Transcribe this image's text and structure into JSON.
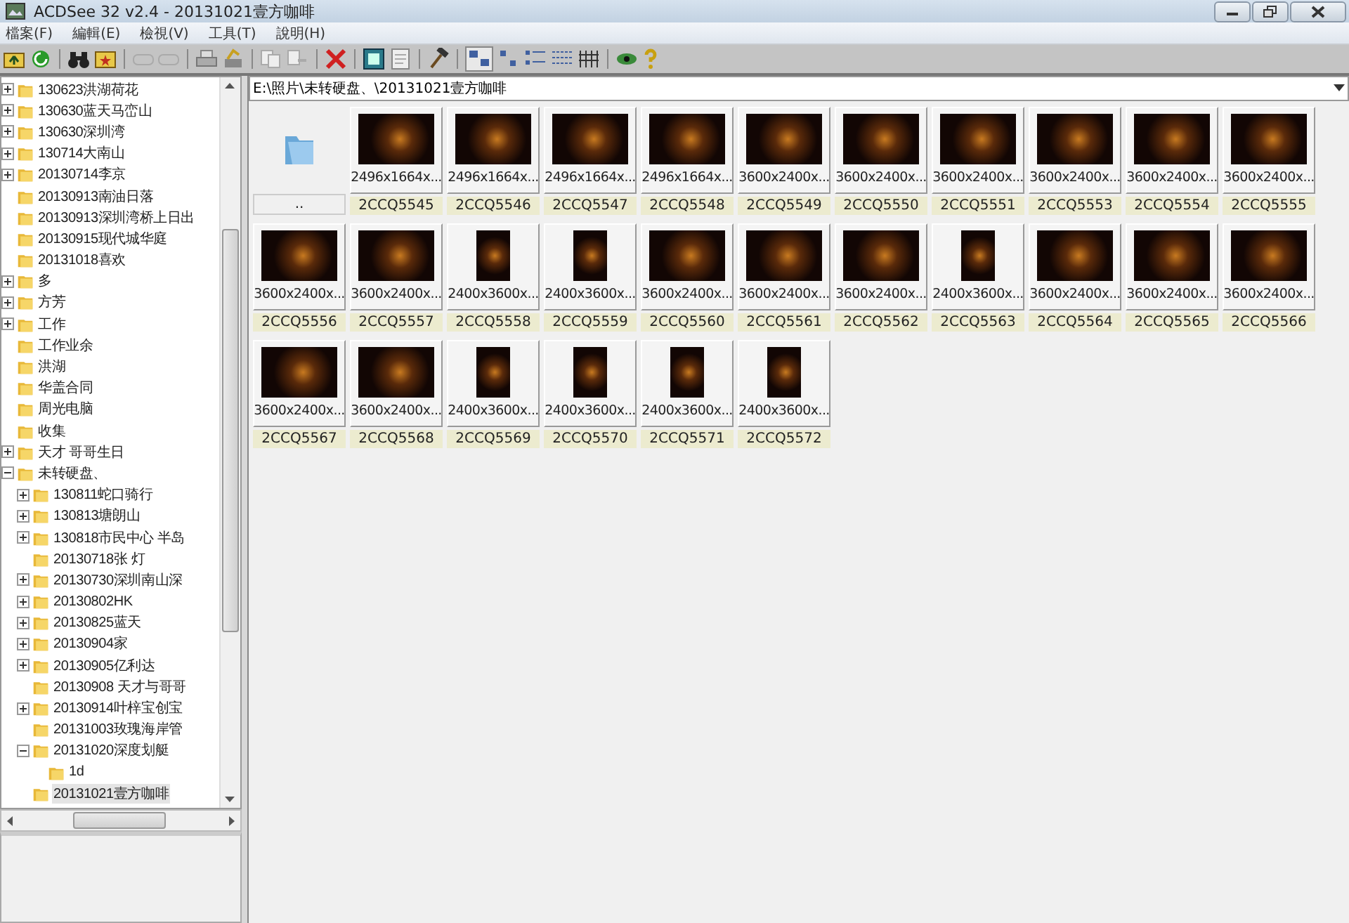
{
  "window": {
    "title": "ACDSee 32 v2.4 - 20131021壹方咖啡"
  },
  "menu": [
    "檔案(F)",
    "編輯(E)",
    "檢視(V)",
    "工具(T)",
    "說明(H)"
  ],
  "address": {
    "value": "E:\\照片\\未转硬盘、\\20131021壹方咖啡"
  },
  "tree": [
    {
      "label": "130623洪湖荷花",
      "expandable": true,
      "selected": false
    },
    {
      "label": "130630蓝天马峦山",
      "expandable": true,
      "selected": false
    },
    {
      "label": "130630深圳湾",
      "expandable": true,
      "selected": false
    },
    {
      "label": "130714大南山",
      "expandable": true,
      "selected": false
    },
    {
      "label": "20130714李京",
      "expandable": true,
      "selected": false
    },
    {
      "label": "20130913南油日落",
      "expandable": false,
      "selected": false
    },
    {
      "label": "20130913深圳湾桥上日出",
      "expandable": false,
      "selected": false
    },
    {
      "label": "20130915现代城华庭",
      "expandable": false,
      "selected": false
    },
    {
      "label": "20131018喜欢",
      "expandable": false,
      "selected": false
    },
    {
      "label": "多",
      "expandable": true,
      "selected": false
    },
    {
      "label": "方芳",
      "expandable": true,
      "selected": false
    },
    {
      "label": "工作",
      "expandable": true,
      "selected": false
    },
    {
      "label": "工作业余",
      "expandable": false,
      "selected": false
    },
    {
      "label": "洪湖",
      "expandable": false,
      "selected": false
    },
    {
      "label": "华盖合同",
      "expandable": false,
      "selected": false
    },
    {
      "label": "周光电脑",
      "expandable": false,
      "selected": false
    },
    {
      "label": "收集",
      "expandable": false,
      "selected": false
    },
    {
      "label": "天才 哥哥生日",
      "expandable": true,
      "selected": false
    },
    {
      "label": "未转硬盘、",
      "expandable": true,
      "selected": false,
      "children": [
        {
          "label": "130811蛇口骑行",
          "expandable": true,
          "selected": false
        },
        {
          "label": "130813塘朗山",
          "expandable": true,
          "selected": false
        },
        {
          "label": "130818市民中心 半岛",
          "expandable": true,
          "selected": false
        },
        {
          "label": "20130718张 灯",
          "expandable": false,
          "selected": false
        },
        {
          "label": "20130730深圳南山深",
          "expandable": true,
          "selected": false
        },
        {
          "label": "20130802HK",
          "expandable": true,
          "selected": false
        },
        {
          "label": "20130825蓝天",
          "expandable": true,
          "selected": false
        },
        {
          "label": "20130904家",
          "expandable": true,
          "selected": false
        },
        {
          "label": "20130905亿利达",
          "expandable": true,
          "selected": false
        },
        {
          "label": "20130908 天才与哥哥",
          "expandable": false,
          "selected": false
        },
        {
          "label": "20130914叶梓宝创宝",
          "expandable": true,
          "selected": false
        },
        {
          "label": "20131003玫瑰海岸管",
          "expandable": false,
          "selected": false
        },
        {
          "label": "20131020深度划艇",
          "expandable": true,
          "selected": false,
          "children": [
            {
              "label": "1d",
              "expandable": false,
              "selected": false
            }
          ]
        },
        {
          "label": "20131021壹方咖啡",
          "expandable": false,
          "selected": true
        }
      ]
    }
  ],
  "thumbnails": [
    {
      "kind": "folder",
      "name": ".."
    },
    {
      "kind": "image",
      "portrait": false,
      "info": "2496x1664x...",
      "name": "2CCQ5545"
    },
    {
      "kind": "image",
      "portrait": false,
      "info": "2496x1664x...",
      "name": "2CCQ5546"
    },
    {
      "kind": "image",
      "portrait": false,
      "info": "2496x1664x...",
      "name": "2CCQ5547"
    },
    {
      "kind": "image",
      "portrait": false,
      "info": "2496x1664x...",
      "name": "2CCQ5548"
    },
    {
      "kind": "image",
      "portrait": false,
      "info": "3600x2400x...",
      "name": "2CCQ5549"
    },
    {
      "kind": "image",
      "portrait": false,
      "info": "3600x2400x...",
      "name": "2CCQ5550"
    },
    {
      "kind": "image",
      "portrait": false,
      "info": "3600x2400x...",
      "name": "2CCQ5551"
    },
    {
      "kind": "image",
      "portrait": false,
      "info": "3600x2400x...",
      "name": "2CCQ5553"
    },
    {
      "kind": "image",
      "portrait": false,
      "info": "3600x2400x...",
      "name": "2CCQ5554"
    },
    {
      "kind": "image",
      "portrait": false,
      "info": "3600x2400x...",
      "name": "2CCQ5555"
    },
    {
      "kind": "image",
      "portrait": false,
      "info": "3600x2400x...",
      "name": "2CCQ5556"
    },
    {
      "kind": "image",
      "portrait": false,
      "info": "3600x2400x...",
      "name": "2CCQ5557"
    },
    {
      "kind": "image",
      "portrait": true,
      "info": "2400x3600x...",
      "name": "2CCQ5558"
    },
    {
      "kind": "image",
      "portrait": true,
      "info": "2400x3600x...",
      "name": "2CCQ5559"
    },
    {
      "kind": "image",
      "portrait": false,
      "info": "3600x2400x...",
      "name": "2CCQ5560"
    },
    {
      "kind": "image",
      "portrait": false,
      "info": "3600x2400x...",
      "name": "2CCQ5561"
    },
    {
      "kind": "image",
      "portrait": false,
      "info": "3600x2400x...",
      "name": "2CCQ5562"
    },
    {
      "kind": "image",
      "portrait": true,
      "info": "2400x3600x...",
      "name": "2CCQ5563"
    },
    {
      "kind": "image",
      "portrait": false,
      "info": "3600x2400x...",
      "name": "2CCQ5564"
    },
    {
      "kind": "image",
      "portrait": false,
      "info": "3600x2400x...",
      "name": "2CCQ5565"
    },
    {
      "kind": "image",
      "portrait": false,
      "info": "3600x2400x...",
      "name": "2CCQ5566"
    },
    {
      "kind": "image",
      "portrait": false,
      "info": "3600x2400x...",
      "name": "2CCQ5567"
    },
    {
      "kind": "image",
      "portrait": false,
      "info": "3600x2400x...",
      "name": "2CCQ5568"
    },
    {
      "kind": "image",
      "portrait": true,
      "info": "2400x3600x...",
      "name": "2CCQ5569"
    },
    {
      "kind": "image",
      "portrait": true,
      "info": "2400x3600x...",
      "name": "2CCQ5570"
    },
    {
      "kind": "image",
      "portrait": true,
      "info": "2400x3600x...",
      "name": "2CCQ5571"
    },
    {
      "kind": "image",
      "portrait": true,
      "info": "2400x3600x...",
      "name": "2CCQ5572"
    }
  ]
}
